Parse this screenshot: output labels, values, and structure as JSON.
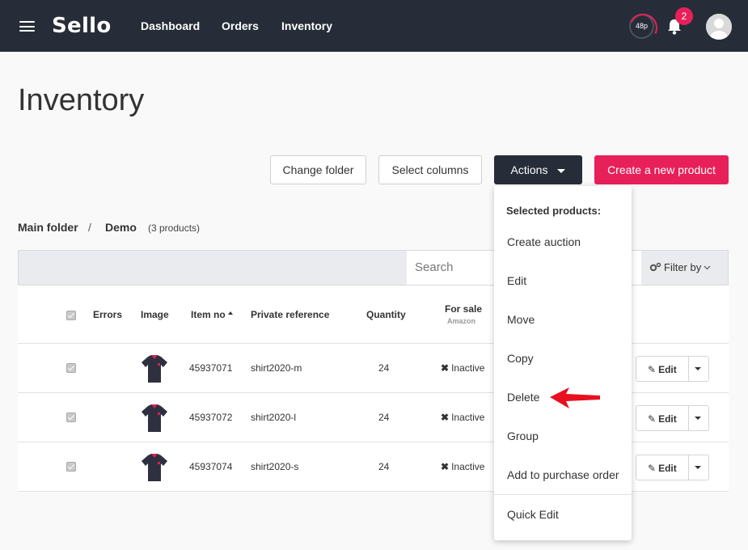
{
  "app": {
    "brand": "Sello"
  },
  "nav": {
    "links": [
      "Dashboard",
      "Orders",
      "Inventory"
    ],
    "speed_label": "48p",
    "notification_count": "2"
  },
  "page": {
    "title": "Inventory"
  },
  "buttons": {
    "change_folder": "Change folder",
    "select_columns": "Select columns",
    "actions": "Actions",
    "create_product": "Create a new product"
  },
  "breadcrumb": {
    "root": "Main folder",
    "separator": "/",
    "folder": "Demo",
    "count": "(3 products)"
  },
  "toolbar": {
    "search_placeholder": "Search",
    "filter_label": "Filter by"
  },
  "table": {
    "headers": {
      "errors": "Errors",
      "image": "Image",
      "item_no": "Item no",
      "private_reference": "Private reference",
      "quantity": "Quantity",
      "for_sale": "For sale",
      "for_sale_sub": "Amazon"
    },
    "rows": [
      {
        "item_no": "45937071",
        "reference": "shirt2020-m",
        "quantity": "24",
        "status": "Inactive",
        "edit": "Edit"
      },
      {
        "item_no": "45937072",
        "reference": "shirt2020-l",
        "quantity": "24",
        "status": "Inactive",
        "edit": "Edit"
      },
      {
        "item_no": "45937074",
        "reference": "shirt2020-s",
        "quantity": "24",
        "status": "Inactive",
        "edit": "Edit"
      }
    ]
  },
  "actions_menu": {
    "header": "Selected products:",
    "items": [
      "Create auction",
      "Edit",
      "Move",
      "Copy",
      "Delete",
      "Group",
      "Add to purchase order"
    ],
    "footer_item": "Quick Edit"
  },
  "colors": {
    "nav_bg": "#272d38",
    "accent": "#e8205a",
    "annotation_arrow": "#e8101e"
  }
}
